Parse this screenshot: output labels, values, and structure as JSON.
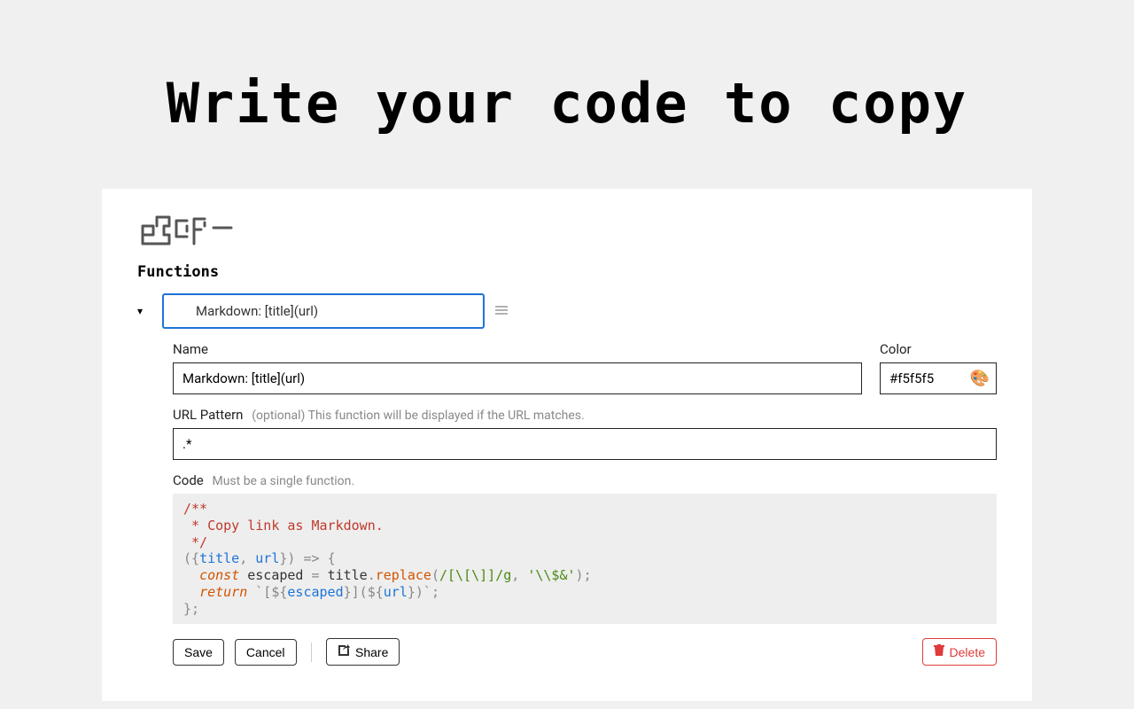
{
  "hero": "Write your code to copy",
  "section_title": "Functions",
  "selected": "Markdown: [title](url)",
  "labels": {
    "name": "Name",
    "color": "Color",
    "url_pattern": "URL Pattern",
    "url_pattern_hint": "(optional) This function will be displayed if the URL matches.",
    "code": "Code",
    "code_hint": "Must be a single function."
  },
  "values": {
    "name": "Markdown: [title](url)",
    "color": "#f5f5f5",
    "url_pattern": ".*"
  },
  "code": {
    "line1": "/**",
    "line2": " * Copy link as Markdown.",
    "line3": " */",
    "l4_prop1": "title",
    "l4_prop2": "url",
    "l5_kw": "const",
    "l5_var1": "escaped",
    "l5_var2": "title",
    "l5_method": "replace",
    "l5_regex": "/[\\[\\]]/g",
    "l5_str": "'\\\\$&'",
    "l6_kw": "return",
    "l6_var1": "escaped",
    "l6_var2": "url"
  },
  "buttons": {
    "save": "Save",
    "cancel": "Cancel",
    "share": "Share",
    "delete": "Delete"
  }
}
